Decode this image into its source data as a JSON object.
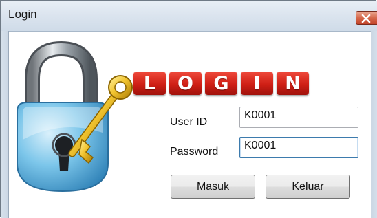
{
  "window": {
    "title": "Login"
  },
  "logo": {
    "letters": [
      "L",
      "O",
      "G",
      "I",
      "N"
    ],
    "tile_color": "#d11f16"
  },
  "form": {
    "user_id": {
      "label": "User ID",
      "value": "K0001"
    },
    "password": {
      "label": "Password",
      "value": "K0001"
    }
  },
  "buttons": {
    "masuk": "Masuk",
    "keluar": "Keluar"
  },
  "icons": {
    "close": "close-icon",
    "padlock": "padlock-with-key-icon"
  }
}
